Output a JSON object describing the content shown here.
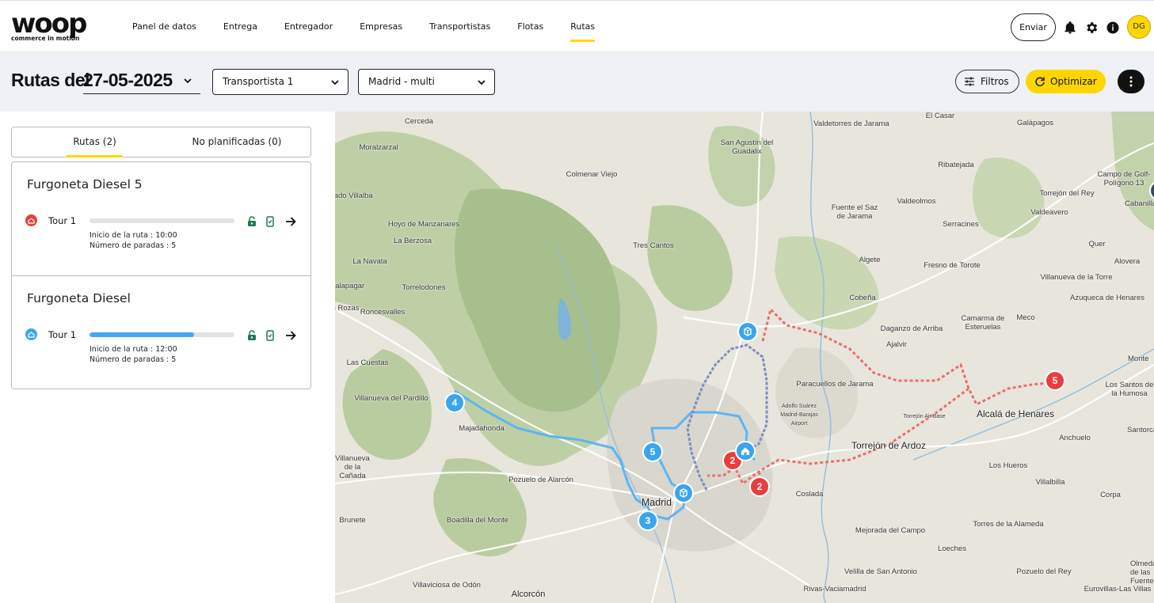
{
  "brand": {
    "name": "woop",
    "tagline": "commerce in motion"
  },
  "nav": {
    "items": [
      {
        "label": "Panel de datos"
      },
      {
        "label": "Entrega"
      },
      {
        "label": "Entregador"
      },
      {
        "label": "Empresas"
      },
      {
        "label": "Transportistas"
      },
      {
        "label": "Flotas"
      },
      {
        "label": "Rutas"
      }
    ],
    "active": "Rutas",
    "send_label": "Enviar",
    "icons": [
      "bell-icon",
      "gear-icon",
      "info-icon"
    ],
    "avatar_initials": "DG"
  },
  "header": {
    "title": "Rutas del",
    "date": "27-05-2025",
    "carrier_select": "Transportista 1",
    "zone_select": "Madrid - multi",
    "filters_label": "Filtros",
    "optimize_label": "Optimizar"
  },
  "tabs": [
    {
      "label": "Rutas (2)",
      "active": true
    },
    {
      "label": "No planificadas (0)",
      "active": false
    }
  ],
  "routes": [
    {
      "vehicle": "Furgoneta Diesel 5",
      "tour": "Tour 1",
      "icon_color": "#e8403a",
      "progress": 0,
      "start_line": "Inicio de la ruta : 10:00",
      "stops_line": "Número de paradas : 5"
    },
    {
      "vehicle": "Furgoneta Diesel",
      "tour": "Tour 1",
      "icon_color": "#3aa5ef",
      "progress": 0.72,
      "start_line": "Inicio de la ruta : 12:00",
      "stops_line": "Número de paradas : 5"
    }
  ],
  "map": {
    "labels": [
      "Cerceda",
      "Moralzarzal",
      "Collado Villalba",
      "La Berzosa",
      "Hoyo de Manzanares",
      "Colmenar Viejo",
      "La Navata",
      "Galapagar",
      "Torrelodones",
      "Las Rozas",
      "Roncesvalles",
      "Las Cuestas",
      "Villanueva del Pardillo",
      "Majadahonda",
      "Villanueva de la Cañada",
      "Pozuelo de Alarcón",
      "Madrid",
      "Brunete",
      "Boadilla del Monte",
      "Villaviciosa de Odón",
      "Alcorcón",
      "Tres Cantos",
      "San Agustín del Guadalix",
      "Valdetorres de Jarama",
      "El Casar",
      "Galápagos",
      "Ribatejada",
      "Fuente el Saz de Jarama",
      "Valdeolmos",
      "Algete",
      "Cobeña",
      "Fresno de Torote",
      "Serracines",
      "Torrejón del Rey",
      "Valdeavero",
      "Campo de Golf-Polígono 13",
      "Cabanillas del Campo",
      "Quer",
      "Alovera",
      "Villanueva de la Torre",
      "Azuqueca de Henares",
      "Meco",
      "Camarma de Esteruelas",
      "Daganzo de Arriba",
      "Ajalvir",
      "Paracuellos de Jarama",
      "Adolfo Suárez Madrid-Barajas Airport",
      "Torrejón Air Base",
      "Alcalá de Henares",
      "Los Santos de la Humosa",
      "Torrejón de Ardoz",
      "Anchuelo",
      "Santorcaz",
      "Los Hueros",
      "Villalbilla",
      "Corpa",
      "Coslada",
      "Mejorada del Campo",
      "Torres de la Alameda",
      "Loeches",
      "Velilla de San Antonio",
      "Rivas-Vaciamadrid",
      "Pozuelo del Rey",
      "Eurovillas-Las Villas",
      "Olmeda de las Fuentes",
      "Monte"
    ],
    "stops_blue": [
      "4",
      "5",
      "3"
    ],
    "stops_red": [
      "2",
      "2",
      "5"
    ],
    "route_colors": {
      "blue": "#5bb5f5",
      "red": "#e9706b",
      "grey_blue": "#7b8fc4"
    }
  }
}
